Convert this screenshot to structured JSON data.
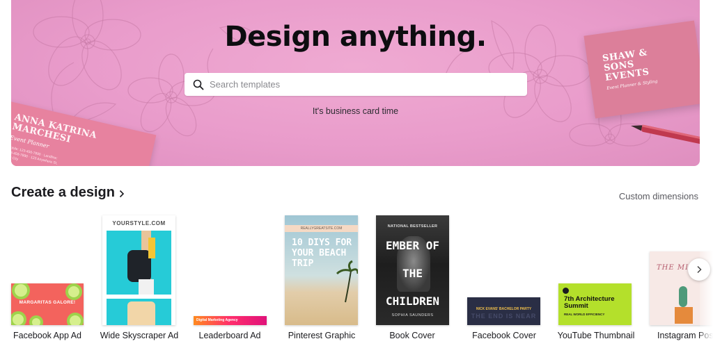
{
  "hero": {
    "title": "Design anything.",
    "subtitle": "It's business card time",
    "search_placeholder": "Search templates",
    "card_left": {
      "name": "ANNA KATRINA MARCHESI",
      "role": "Event Planner",
      "details": "Mobile: 123-456-7890 · Landline: 123-456-7890 · 123 Anywhere St, Any City"
    },
    "card_right": {
      "name": "SHAW & SONS EVENTS",
      "tagline": "Event Planner & Styling"
    },
    "background_color": "#e99ccb"
  },
  "section": {
    "title": "Create a design",
    "custom_dimensions": "Custom dimensions"
  },
  "designs": [
    {
      "label": "Facebook App Ad",
      "thumb_text": "MARGARITAS GALORE!"
    },
    {
      "label": "Wide Skyscraper Ad",
      "thumb_text": "YOURSTYLE.COM"
    },
    {
      "label": "Leaderboard Ad",
      "thumb_text": "Digital Marketing Agency"
    },
    {
      "label": "Pinterest Graphic",
      "thumb_text": "10 DIYS FOR YOUR BEACH TRIP",
      "thumb_url": "REALLYGREATSITE.COM"
    },
    {
      "label": "Book Cover",
      "thumb_kicker": "NATIONAL BESTSELLER",
      "thumb_text": "EMBER OF THE CHILDREN",
      "thumb_author": "SOPHIA SAUNDERS"
    },
    {
      "label": "Facebook Cover",
      "thumb_text": "NICK EVANS' BACHELOR PARTY",
      "thumb_big": "THE END IS NEAR"
    },
    {
      "label": "YouTube Thumbnail",
      "thumb_text": "7th Architecture Summit",
      "thumb_sub": "REAL WORLD EFFICIENCY"
    },
    {
      "label": "Instagram Post",
      "thumb_text": "THE MINI"
    }
  ],
  "icons": {
    "search": "search-icon",
    "section_chevron": "chevron-right-icon",
    "carousel_next": "chevron-right-icon"
  }
}
